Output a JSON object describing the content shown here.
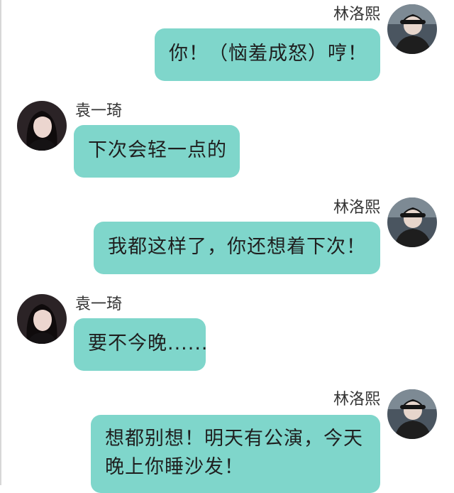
{
  "colors": {
    "bubble": "#7fd6cb",
    "background": "#ffffff",
    "text": "#1f1f1f",
    "name": "#333333"
  },
  "participants": {
    "self_name": "林洛熙",
    "other_name": "袁一琦"
  },
  "messages": [
    {
      "sender": "林洛熙",
      "side": "right",
      "text": "你！（恼羞成怒）哼！"
    },
    {
      "sender": "袁一琦",
      "side": "left",
      "text": "下次会轻一点的"
    },
    {
      "sender": "林洛熙",
      "side": "right",
      "text": "我都这样了，你还想着下次！"
    },
    {
      "sender": "袁一琦",
      "side": "left",
      "text": "要不今晚......"
    },
    {
      "sender": "林洛熙",
      "side": "right",
      "text": "想都别想！明天有公演，今天晚上你睡沙发！"
    }
  ],
  "icons": {
    "self_avatar": "avatar-photo-icon",
    "other_avatar": "avatar-photo-icon"
  }
}
